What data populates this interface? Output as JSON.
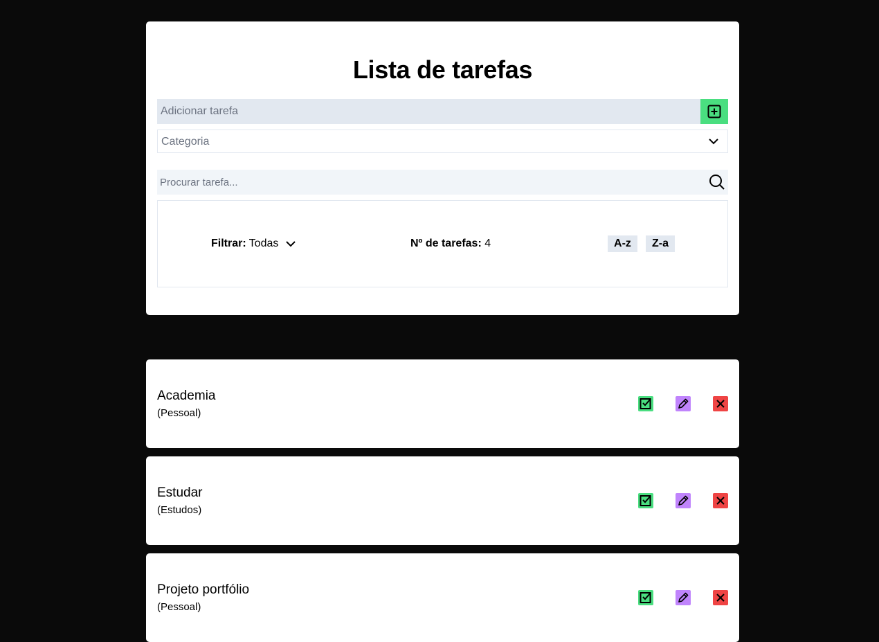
{
  "header": {
    "title": "Lista de tarefas"
  },
  "add_task": {
    "placeholder": "Adicionar tarefa",
    "button_icon": "plus-square-icon"
  },
  "category_select": {
    "placeholder": "Categoria",
    "icon": "chevron-down-icon"
  },
  "search": {
    "placeholder": "Procurar tarefa...",
    "icon": "search-icon"
  },
  "filter": {
    "label": "Filtrar:",
    "value": "Todas",
    "count_label": "Nº de tarefas:",
    "count_value": "4",
    "sort_asc_label": "A-z",
    "sort_desc_label": "Z-a"
  },
  "tasks": [
    {
      "title": "Academia",
      "category": "(Pessoal)"
    },
    {
      "title": "Estudar",
      "category": "(Estudos)"
    },
    {
      "title": "Projeto portfólio",
      "category": "(Pessoal)"
    }
  ],
  "colors": {
    "background": "#0a0a0a",
    "add_button": "#4ade80",
    "complete_button": "#4ade80",
    "edit_button": "#c084fc",
    "delete_button": "#ef4444",
    "input_bg": "#e2e8f0"
  }
}
